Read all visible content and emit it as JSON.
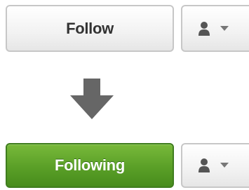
{
  "before": {
    "follow_label": "Follow",
    "user_menu_icon": "user-icon",
    "caret_icon": "chevron-down-icon"
  },
  "transition": {
    "icon": "arrow-down-icon",
    "color": "#666666"
  },
  "after": {
    "following_label": "Following",
    "following_color": "#5a9f27",
    "user_menu_icon": "user-icon",
    "caret_icon": "chevron-down-icon"
  }
}
